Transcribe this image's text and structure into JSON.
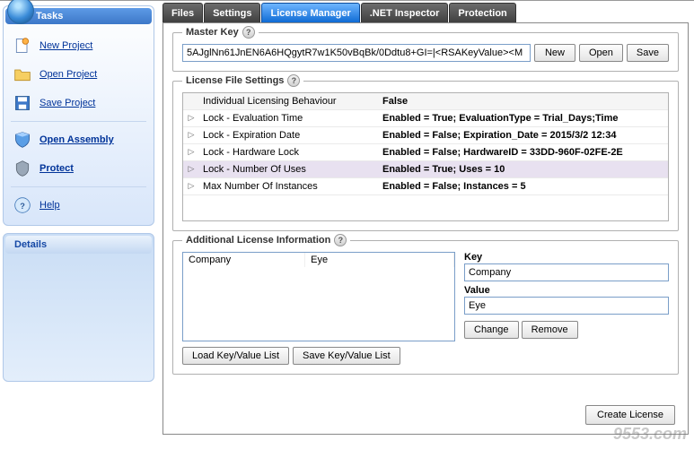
{
  "sidebar": {
    "tasks_title": "Tasks",
    "details_title": "Details",
    "items": [
      {
        "label": "New Project",
        "bold": false
      },
      {
        "label": "Open Project",
        "bold": false
      },
      {
        "label": "Save Project",
        "bold": false
      },
      {
        "label": "Open Assembly",
        "bold": true
      },
      {
        "label": "Protect",
        "bold": true
      },
      {
        "label": "Help",
        "bold": false
      }
    ]
  },
  "tabs": [
    {
      "label": "Files",
      "active": false
    },
    {
      "label": "Settings",
      "active": false
    },
    {
      "label": "License Manager",
      "active": true
    },
    {
      "label": ".NET Inspector",
      "active": false
    },
    {
      "label": "Protection",
      "active": false
    }
  ],
  "master_key": {
    "legend": "Master Key",
    "value": "5AJglNn61JnEN6A6HQgytR7w1K50vBqBk/0Ddtu8+GI=|<RSAKeyValue><M",
    "btn_new": "New",
    "btn_open": "Open",
    "btn_save": "Save"
  },
  "license_settings": {
    "legend": "License File Settings",
    "rows": [
      {
        "name": "Individual Licensing Behaviour",
        "value": "False",
        "expandable": false,
        "selected": false
      },
      {
        "name": "Lock - Evaluation Time",
        "value": "Enabled = True; EvaluationType = Trial_Days;Time",
        "expandable": true,
        "selected": false
      },
      {
        "name": "Lock - Expiration Date",
        "value": "Enabled = False; Expiration_Date = 2015/3/2 12:34",
        "expandable": true,
        "selected": false
      },
      {
        "name": "Lock - Hardware Lock",
        "value": "Enabled = False; HardwareID = 33DD-960F-02FE-2E",
        "expandable": true,
        "selected": false
      },
      {
        "name": "Lock - Number Of Uses",
        "value": "Enabled = True; Uses = 10",
        "expandable": true,
        "selected": true
      },
      {
        "name": "Max Number Of Instances",
        "value": "Enabled = False; Instances = 5",
        "expandable": true,
        "selected": false
      }
    ]
  },
  "additional": {
    "legend": "Additional License Information",
    "list_headers": {
      "key": "Company",
      "value": "Eye"
    },
    "key_label": "Key",
    "key_value": "Company",
    "value_label": "Value",
    "value_value": "Eye",
    "btn_change": "Change",
    "btn_remove": "Remove",
    "btn_load": "Load Key/Value List",
    "btn_save": "Save Key/Value List"
  },
  "btn_create": "Create License",
  "watermark": "9553.com"
}
